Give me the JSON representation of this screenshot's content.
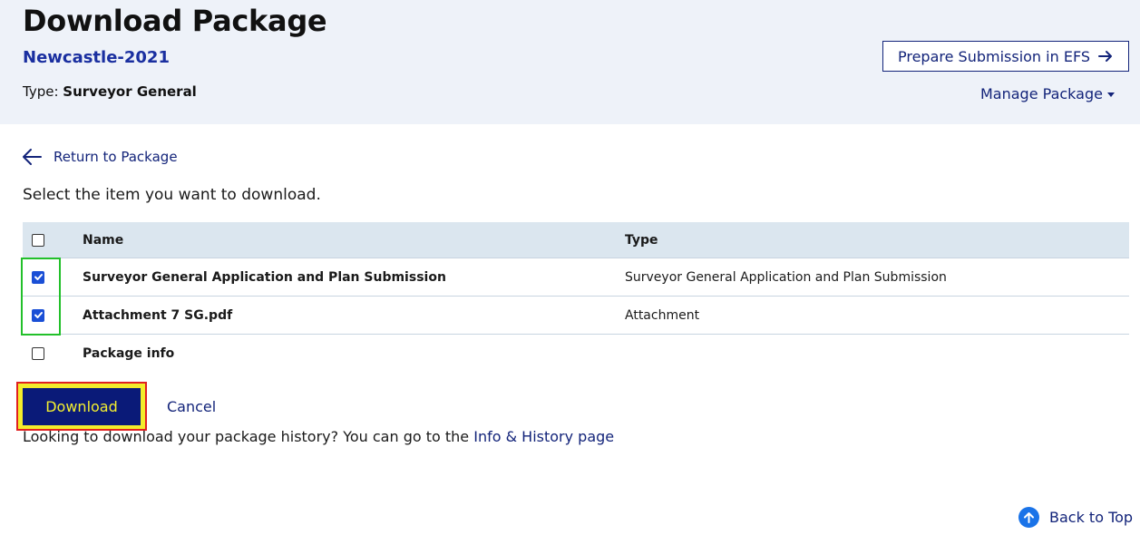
{
  "header": {
    "title": "Download Package",
    "package_name": "Newcastle-2021",
    "type_label": "Type:",
    "type_value": "Surveyor General",
    "prepare_button": "Prepare Submission in EFS",
    "manage_menu": "Manage Package"
  },
  "nav": {
    "return_link": "Return to Package"
  },
  "instruction": "Select the item you want to download.",
  "table": {
    "headers": {
      "name": "Name",
      "type": "Type"
    },
    "rows": [
      {
        "name": "Surveyor General Application and Plan Submission",
        "type": "Surveyor General Application and Plan Submission",
        "checked": true
      },
      {
        "name": "Attachment 7 SG.pdf",
        "type": "Attachment",
        "checked": true
      },
      {
        "name": "Package info",
        "type": "",
        "checked": false
      }
    ]
  },
  "actions": {
    "download": "Download",
    "cancel": "Cancel"
  },
  "history": {
    "text": "Looking to download your package history? You can go to the ",
    "link": "Info & History page"
  },
  "footer": {
    "back_to_top": "Back to Top"
  },
  "colors": {
    "primary": "#13247a",
    "header_bg": "#eef2f9",
    "table_head_bg": "#dbe6ef",
    "download_bg": "#0a1a78",
    "download_text": "#f4ef2f",
    "checkbox_checked": "#1a4fd6",
    "highlight_green": "#22c02a",
    "highlight_red": "#e02020"
  },
  "icons": {
    "prepare_button": "arrow-right-icon",
    "manage_menu": "caret-down-icon",
    "return_link": "arrow-left-icon",
    "back_to_top": "arrow-up-circle-icon"
  }
}
